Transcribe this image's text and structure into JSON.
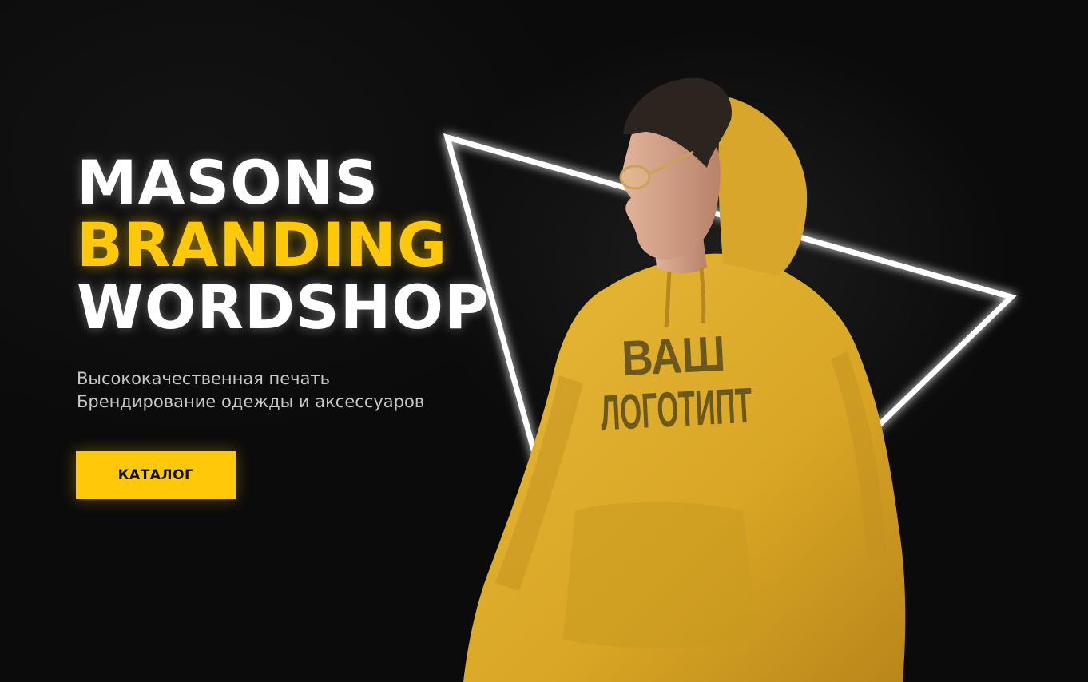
{
  "hero": {
    "headline": {
      "line1": "MASONS",
      "line2": "BRANDING",
      "line3": "WORDSHOP"
    },
    "subtitle": {
      "line1": "Высококачественная печать",
      "line2": "Брендирование одежды и аксессуаров"
    },
    "cta_label": "КАТАЛОГ",
    "hoodie_print": {
      "line1": "ВАШ",
      "line2": "ЛОГОТИПТ"
    }
  },
  "colors": {
    "background": "#0b0b0b",
    "accent": "#ffc90a",
    "text_primary": "#ffffff",
    "text_secondary": "#c8c8c8",
    "hoodie": "#e0ae2a"
  },
  "icons": {
    "decor": "neon-triangle"
  }
}
